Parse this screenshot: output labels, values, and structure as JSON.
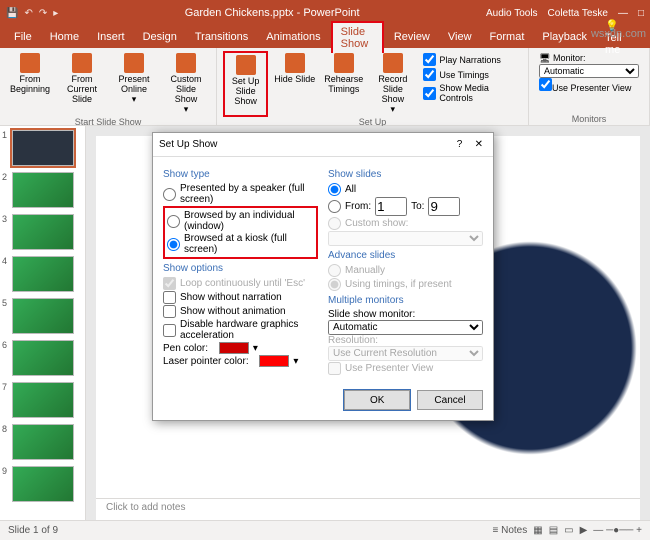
{
  "titlebar": {
    "doc": "Garden Chickens.pptx - PowerPoint",
    "context": "Audio Tools",
    "user": "Coletta Teske"
  },
  "tabs": [
    "File",
    "Home",
    "Insert",
    "Design",
    "Transitions",
    "Animations",
    "Slide Show",
    "Review",
    "View",
    "Format",
    "Playback",
    "Tell me"
  ],
  "activeTab": "Slide Show",
  "ribbon": {
    "group1": {
      "label": "Start Slide Show",
      "btns": [
        "From Beginning",
        "From Current Slide",
        "Present Online",
        "Custom Slide Show"
      ]
    },
    "group2": {
      "label": "Set Up",
      "btns": [
        "Set Up Slide Show",
        "Hide Slide",
        "Rehearse Timings",
        "Record Slide Show"
      ],
      "checks": [
        "Play Narrations",
        "Use Timings",
        "Show Media Controls"
      ]
    },
    "group3": {
      "label": "Monitors",
      "monitorLabel": "Monitor:",
      "monitorVal": "Automatic",
      "presenter": "Use Presenter View"
    }
  },
  "thumbs": 9,
  "notes": "Click to add notes",
  "status": {
    "left": "Slide 1 of 9",
    "notes": "Notes"
  },
  "dialog": {
    "title": "Set Up Show",
    "showType": {
      "title": "Show type",
      "o1": "Presented by a speaker (full screen)",
      "o2": "Browsed by an individual (window)",
      "o3": "Browsed at a kiosk (full screen)"
    },
    "showOptions": {
      "title": "Show options",
      "o1": "Loop continuously until 'Esc'",
      "o2": "Show without narration",
      "o3": "Show without animation",
      "o4": "Disable hardware graphics acceleration",
      "pen": "Pen color:",
      "laser": "Laser pointer color:"
    },
    "showSlides": {
      "title": "Show slides",
      "all": "All",
      "from": "From:",
      "to": "To:",
      "v1": "1",
      "v2": "9",
      "custom": "Custom show:"
    },
    "advance": {
      "title": "Advance slides",
      "o1": "Manually",
      "o2": "Using timings, if present"
    },
    "multi": {
      "title": "Multiple monitors",
      "mon": "Slide show monitor:",
      "monv": "Automatic",
      "res": "Resolution:",
      "resv": "Use Current Resolution",
      "pv": "Use Presenter View"
    },
    "ok": "OK",
    "cancel": "Cancel"
  },
  "watermark": "wsxdn.com"
}
